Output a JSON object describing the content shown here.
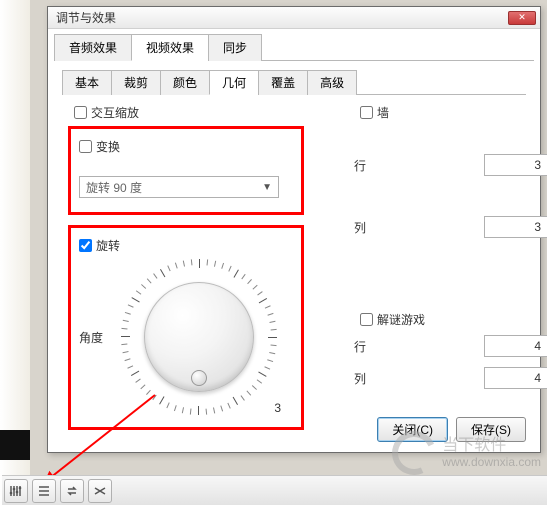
{
  "dialog": {
    "title": "调节与效果",
    "tabs_main": [
      "音频效果",
      "视频效果",
      "同步"
    ],
    "tabs_main_active": 1,
    "tabs_sub": [
      "基本",
      "裁剪",
      "颜色",
      "几何",
      "覆盖",
      "高级"
    ],
    "tabs_sub_active": 3
  },
  "geometry": {
    "interactive_zoom_label": "交互缩放",
    "wall_label": "墙",
    "transform": {
      "label": "变换",
      "combo_value": "旋转 90 度"
    },
    "rotate": {
      "label": "旋转",
      "checked": true,
      "angle_label": "角度",
      "dial_value": "3"
    },
    "row_label": "行",
    "col_label": "列",
    "row1_value": "3",
    "col1_value": "3",
    "puzzle_label": "解谜游戏",
    "row2_value": "4",
    "col2_value": "4"
  },
  "footer": {
    "close_label": "关闭(C)",
    "save_label": "保存(S)"
  },
  "watermark": {
    "site": "当下软件",
    "url": "www.downxia.com"
  }
}
